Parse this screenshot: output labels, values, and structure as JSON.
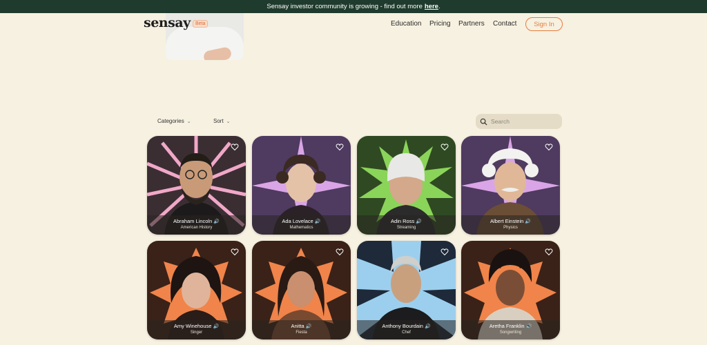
{
  "banner": {
    "text": "Sensay investor community is growing - find out more",
    "link": "here",
    "period": "."
  },
  "logo": {
    "text": "sensay",
    "badge": "Beta"
  },
  "nav": {
    "items": [
      "Education",
      "Pricing",
      "Partners",
      "Contact"
    ],
    "signin": "Sign In"
  },
  "filters": {
    "categories": "Categories",
    "sort": "Sort"
  },
  "search": {
    "placeholder": "Search"
  },
  "speaker_glyph": "🔊",
  "cards": [
    {
      "name": "Abraham Lincoln",
      "category": "American History"
    },
    {
      "name": "Ada Lovelace",
      "category": "Mathematics"
    },
    {
      "name": "Adin Ross",
      "category": "Streaming"
    },
    {
      "name": "Albert Einstein",
      "category": "Physics"
    },
    {
      "name": "Amy Winehouse",
      "category": "Singer"
    },
    {
      "name": "Anitta",
      "category": "Fiesta"
    },
    {
      "name": "Anthony Bourdain",
      "category": "Chef"
    },
    {
      "name": "Aretha Franklin",
      "category": "Songwriting"
    }
  ],
  "colors": {
    "banner": "#1f3b2d",
    "accent": "#e67c3c",
    "page": "#f7f1e1"
  }
}
